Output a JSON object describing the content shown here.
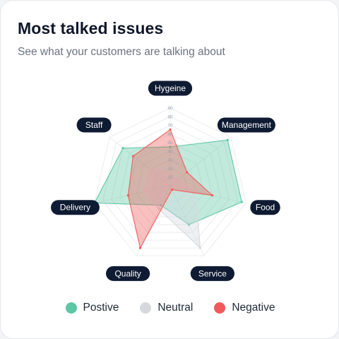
{
  "card": {
    "title": "Most talked issues",
    "subtitle": "See what your customers are talking about"
  },
  "colors": {
    "positive": "#5cc7a2",
    "neutral": "#d6d8de",
    "negative": "#f05a5a",
    "label_bg": "#0f1b33",
    "grid": "#e5e7eb"
  },
  "legend": [
    {
      "name": "Postive",
      "color": "#5cc7a2"
    },
    {
      "name": "Neutral",
      "color": "#d6d8de"
    },
    {
      "name": "Negative",
      "color": "#f05a5a"
    }
  ],
  "chart_data": {
    "type": "radar",
    "categories": [
      "Hygeine",
      "Management",
      "Food",
      "Service",
      "Quality",
      "Delivery",
      "Staff"
    ],
    "ticks": [
      10,
      20,
      30,
      40,
      50,
      60,
      70,
      80,
      90
    ],
    "rlim": [
      0,
      90
    ],
    "grid": true,
    "legend_position": "bottom",
    "series": [
      {
        "name": "Postive",
        "values": [
          45,
          85,
          85,
          50,
          25,
          90,
          70
        ],
        "color": "#5cc7a2"
      },
      {
        "name": "Neutral",
        "values": [
          15,
          10,
          30,
          80,
          30,
          30,
          30
        ],
        "color": "#d6d8de"
      },
      {
        "name": "Negative",
        "values": [
          65,
          25,
          50,
          5,
          80,
          50,
          55
        ],
        "color": "#f05a5a"
      }
    ]
  }
}
